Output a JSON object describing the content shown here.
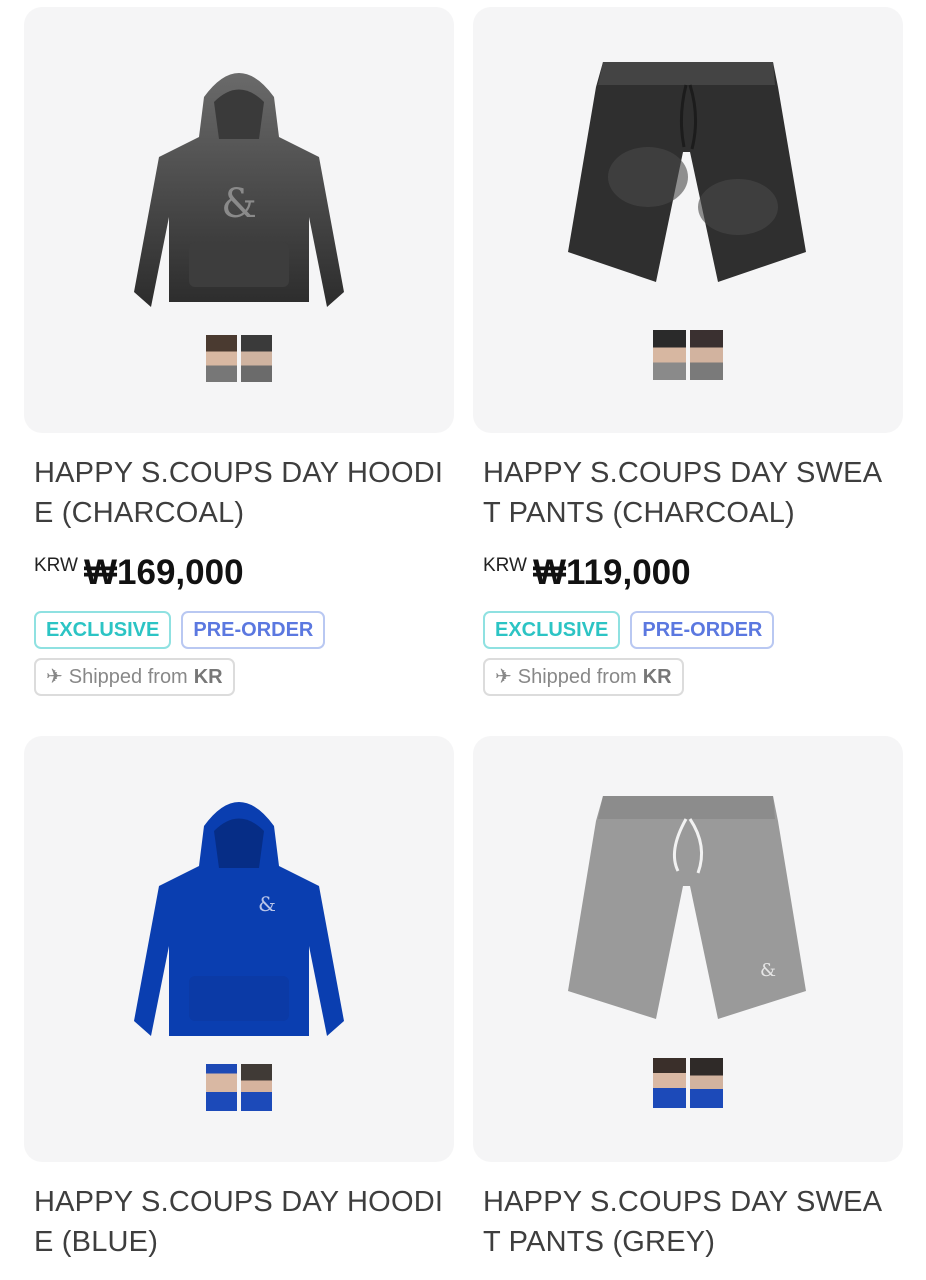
{
  "products": [
    {
      "title": "HAPPY S.COUPS DAY HOODIE (CHARCOAL)",
      "currency": "KRW",
      "price": "₩169,000",
      "badges": [
        "EXCLUSIVE",
        "PRE-ORDER"
      ],
      "shipping": {
        "prefix": "Shipped from",
        "origin": "KR"
      }
    },
    {
      "title": "HAPPY S.COUPS DAY SWEAT PANTS (CHARCOAL)",
      "currency": "KRW",
      "price": "₩119,000",
      "badges": [
        "EXCLUSIVE",
        "PRE-ORDER"
      ],
      "shipping": {
        "prefix": "Shipped from",
        "origin": "KR"
      }
    },
    {
      "title": "HAPPY S.COUPS DAY HOODIE (BLUE)"
    },
    {
      "title": "HAPPY S.COUPS DAY SWEAT PANTS (GREY)"
    }
  ],
  "colors": {
    "exclusive": "#2cc4c4",
    "preorder": "#5b78e0",
    "charcoal": "#3a3a3a",
    "blue": "#0a3eb0",
    "grey": "#9a9a9a"
  }
}
